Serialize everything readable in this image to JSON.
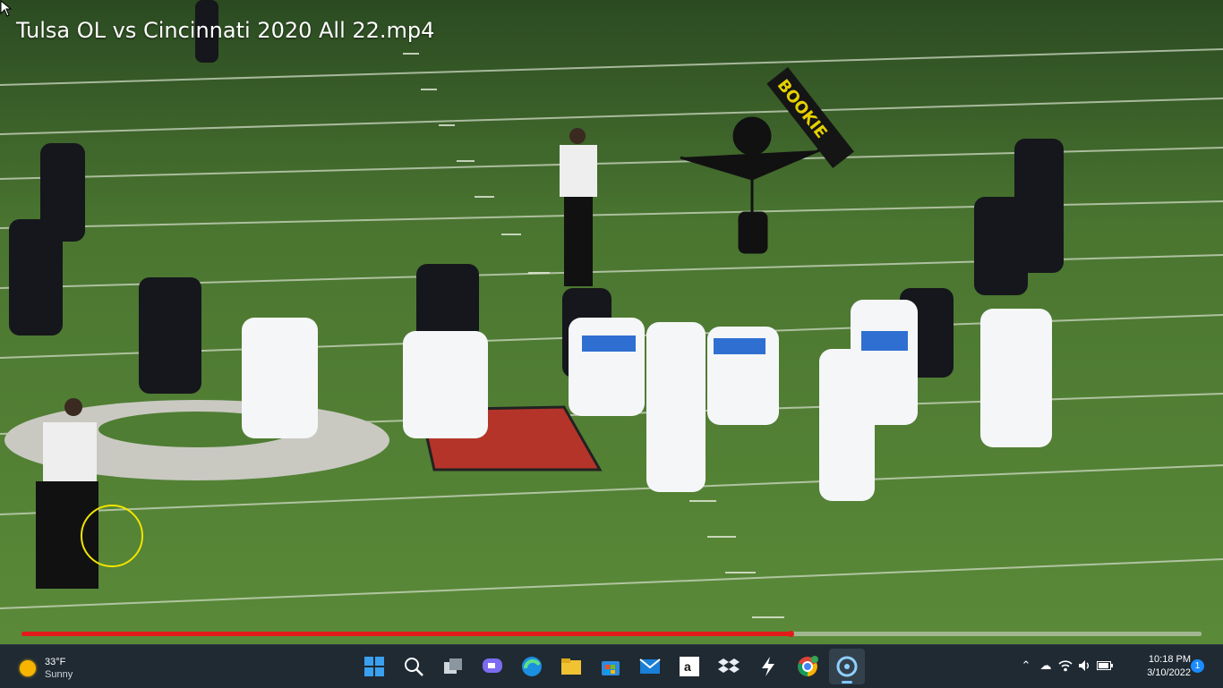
{
  "player": {
    "title": "Tulsa OL vs Cincinnati 2020 All 22.mp4",
    "progress_fraction": 0.652
  },
  "taskbar": {
    "weather": {
      "temp": "33°F",
      "condition": "Sunny"
    },
    "apps": [
      "start-icon",
      "search-icon",
      "task-view-icon",
      "chat-icon",
      "edge-icon",
      "file-explorer-icon",
      "store-icon",
      "mail-icon",
      "amazon-icon",
      "dropbox-icon",
      "bolt-app-icon",
      "chrome-icon",
      "cortana-icon"
    ],
    "clock": {
      "time": "10:18 PM",
      "date": "3/10/2022"
    },
    "notification_count": "1"
  },
  "colors": {
    "field": "#4f7d33",
    "progress": "#e21a1a",
    "taskbar": "#1f2a33"
  }
}
